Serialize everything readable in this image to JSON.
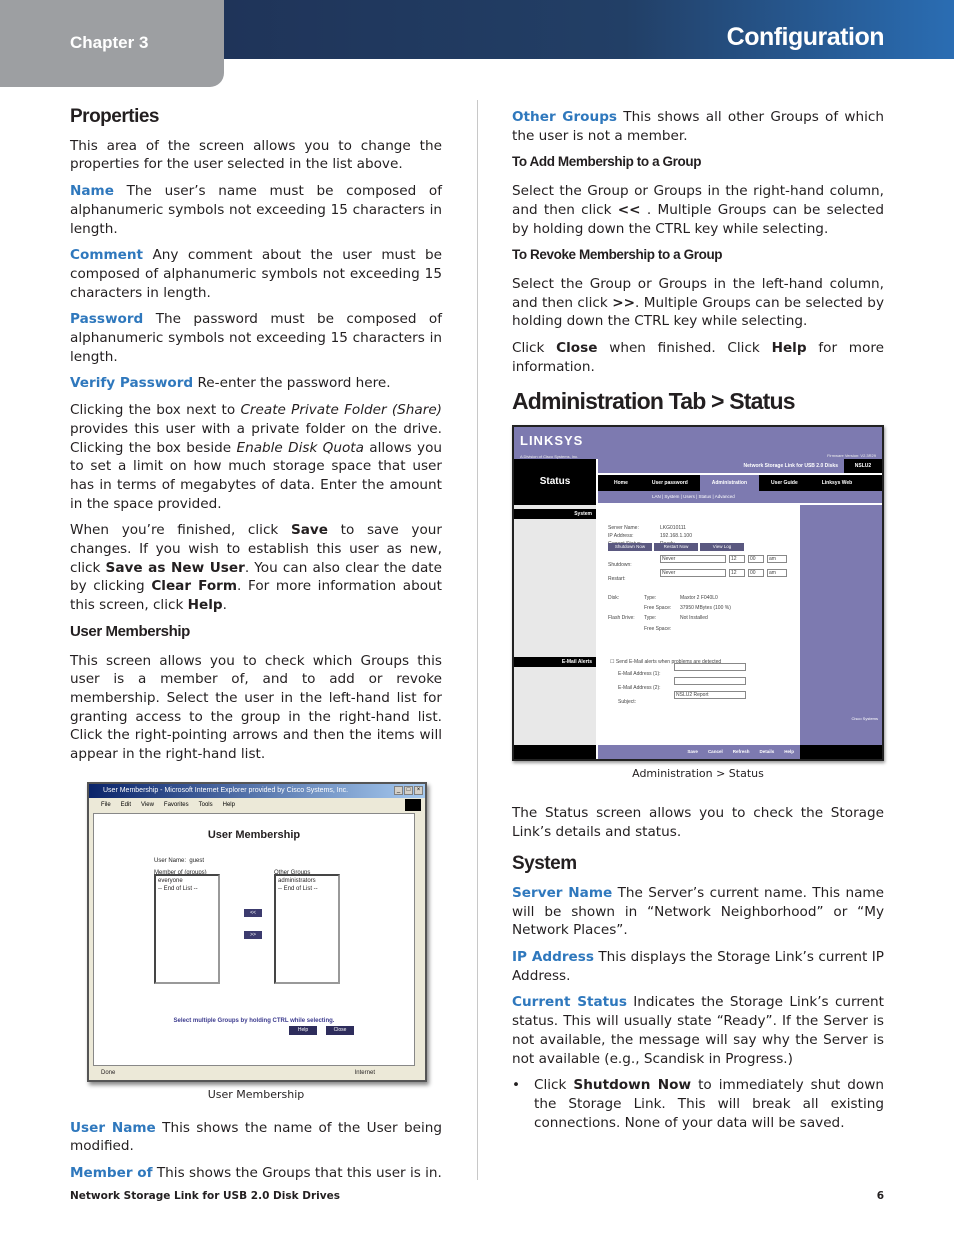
{
  "header": {
    "chapter": "Chapter 3",
    "section": "Configuration"
  },
  "left": {
    "properties_heading": "Properties",
    "properties_intro": "This area of the screen allows you to change the properties for the user selected in the list above.",
    "fields": [
      {
        "term": "Name",
        "desc": " The user’s name must be composed of alphanumeric symbols not exceeding 15 characters in length."
      },
      {
        "term": "Comment",
        "desc": " Any comment about the user must be composed of alphanumeric symbols not exceeding 15 characters in length."
      },
      {
        "term": "Password",
        "desc": " The password must be composed of alphanumeric symbols not exceeding 15 characters in length."
      },
      {
        "term": "Verify Password",
        "desc": "  Re-enter the password here."
      }
    ],
    "private_folder": {
      "t1": "Clicking the box next to ",
      "i1": "Create Private Folder (Share)",
      "t2": " provides this user with a private folder on the drive. Clicking the box beside ",
      "i2": "Enable Disk Quota",
      "t3": " allows you to set a limit on how much storage space that user has in terms of megabytes of data. Enter the amount in the space provided."
    },
    "finish": {
      "t1": "When you’re finished, click ",
      "b1": "Save",
      "t2": " to save your changes. If you wish to establish this user as new, click ",
      "b2": "Save as New User",
      "t3": ". You can also clear the date by clicking ",
      "b3": "Clear Form",
      "t4": ". For more information about this screen, click ",
      "b4": "Help",
      "t5": "."
    },
    "membership_heading": "User Membership",
    "membership_intro": "This screen allows you to check which Groups this user is a member of, and to add or revoke membership. Select the user in the left-hand list for granting access to the group in the right-hand list. Click the right-pointing arrows and then the items will appear in the right-hand list.",
    "figure": {
      "window_title": "User Membership - Microsoft Internet Explorer provided by Cisco Systems, Inc.",
      "menu": [
        "File",
        "Edit",
        "View",
        "Favorites",
        "Tools",
        "Help"
      ],
      "page_title": "User Membership",
      "user_name_label": "User Name:",
      "user_name_value": "guest",
      "member_of_label": "Member of (groups)",
      "other_groups_label": "Other Groups",
      "member_of_items": [
        "everyone",
        "-- End of List --"
      ],
      "other_groups_items": [
        "administrators",
        "-- End of List --"
      ],
      "add_button": "<<",
      "remove_button": ">>",
      "note": "Select multiple Groups by holding CTRL while selecting.",
      "help_button": "Help",
      "close_button": "Close",
      "status_text": "Done",
      "zone_text": "Internet",
      "caption": "User Membership"
    },
    "fields2": [
      {
        "term": "User Name",
        "desc": " This shows the name of the User being modified."
      },
      {
        "term": "Member of",
        "desc": "  This shows the Groups that this user is in."
      }
    ]
  },
  "right": {
    "other_groups": {
      "term": "Other Groups",
      "desc": "  This shows all other Groups of which the user is not a member."
    },
    "add_heading": "To Add Membership to a Group",
    "add_text": {
      "t1": "Select the Group or Groups in the right-hand column, and then click ",
      "b1": "<<",
      "t2": " . Multiple Groups can be selected by holding down the CTRL key while selecting."
    },
    "revoke_heading": "To Revoke Membership to a Group",
    "revoke_text": {
      "t1": "Select the Group or Groups in the left-hand column, and then click ",
      "b1": ">>",
      "t2": ". Multiple Groups can be selected by holding down the CTRL key while selecting."
    },
    "close_text": {
      "t1": "Click ",
      "b1": "Close",
      "t2": " when finished. Click ",
      "b2": "Help",
      "t3": " for more information."
    },
    "admin_heading": "Administration Tab > Status",
    "figure": {
      "logo": "LINKSYS",
      "logo_sub": "A Division of Cisco Systems, Inc.",
      "firmware": "Firmware Version: V2.3R29",
      "page": "Status",
      "product": "Network Storage Link for USB 2.0 Disks",
      "model": "NSLU2",
      "tabs": [
        "Home",
        "User password",
        "Administration",
        "User Guide",
        "Linksys Web"
      ],
      "active_tab": "Administration",
      "subtabs": "LAN | System | Users | Status | Advanced",
      "section_system": "System",
      "section_email": "E-Mail Alerts",
      "server_name_label": "Server Name:",
      "server_name_value": "LKG010111",
      "ip_label": "IP Address:",
      "ip_value": "192.168.1.100",
      "current_status_label": "Current Status:",
      "current_status_value": "Ready",
      "buttons": [
        "Shutdown Now",
        "Restart Now",
        "View Log"
      ],
      "shutdown_label": "Shutdown:",
      "restart_label": "Restart:",
      "schedule_value": "Never",
      "hour": "12",
      "minute": "00",
      "ampm": "am",
      "disk_label": "Disk:",
      "type_label": "Type:",
      "disk_type": "Maxtor 2 F040L0",
      "free_space_label": "Free Space:",
      "disk_free": "37950 MBytes (100 %)",
      "flash_label": "Flash Drive:",
      "flash_type": "Not Installed",
      "email_check": "Send E-Mail alerts when problems are detected",
      "email1_label": "E-Mail Address (1):",
      "email2_label": "E-Mail Address (2):",
      "subject_label": "Subject:",
      "subject_value": "NSLU2 Report",
      "bottom_buttons": [
        "Save",
        "Cancel",
        "Refresh",
        "Details",
        "Help"
      ],
      "cisco": "Cisco Systems",
      "caption": "Administration > Status"
    },
    "status_intro": "The Status screen allows you to check the Storage Link’s details and status.",
    "system_heading": "System",
    "fields": [
      {
        "term": "Server Name",
        "desc": "  The Server’s current name. This name will be shown in “Network Neighborhood” or “My Network Places”."
      },
      {
        "term": "IP Address",
        "desc": " This displays the Storage Link’s current IP Address."
      },
      {
        "term": "Current Status",
        "desc": "  Indicates the Storage Link’s current status. This will usually state “Ready”. If the Server is not available, the message will say why the Server is not available (e.g., Scandisk in Progress.)"
      }
    ],
    "bullet": {
      "t1": "Click ",
      "b1": "Shutdown Now",
      "t2": " to immediately shut down the Storage Link. This will break all existing connections. None of your data will be saved."
    }
  },
  "footer": {
    "title": "Network Storage Link for USB 2.0 Disk Drives",
    "page": "6"
  }
}
